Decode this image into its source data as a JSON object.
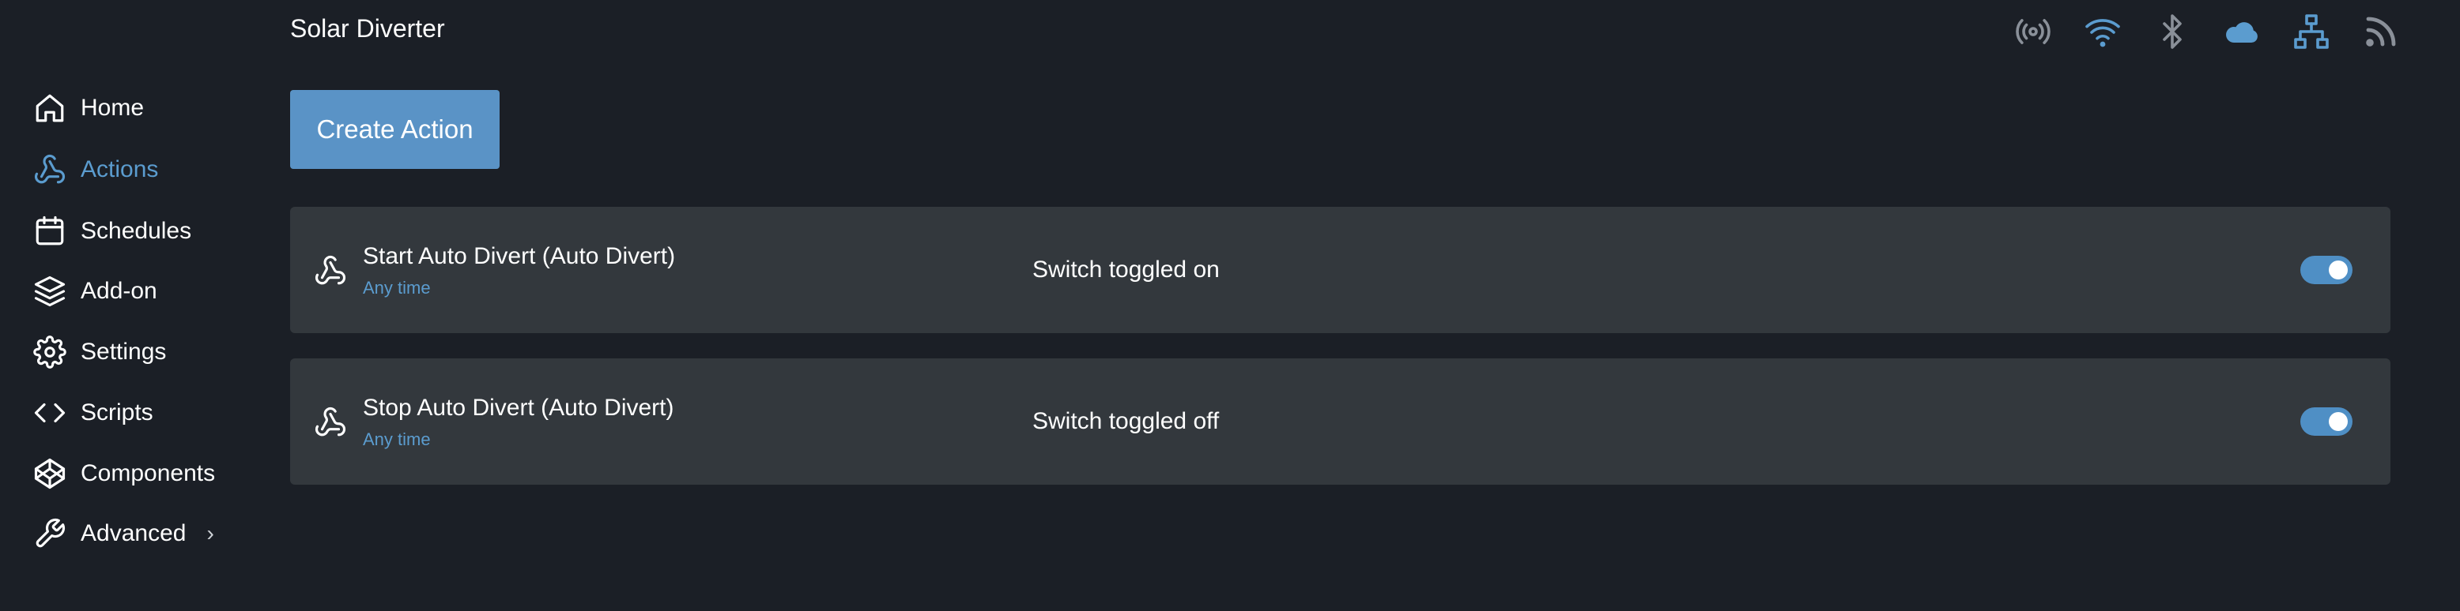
{
  "header": {
    "title": "Solar Diverter"
  },
  "status_icons": [
    {
      "name": "broadcast-icon",
      "color": "#8a9099"
    },
    {
      "name": "wifi-icon",
      "color": "#5b9ccf"
    },
    {
      "name": "bluetooth-icon",
      "color": "#8a9099"
    },
    {
      "name": "cloud-icon",
      "color": "#5b9ccf"
    },
    {
      "name": "network-icon",
      "color": "#5b9ccf"
    },
    {
      "name": "rss-icon",
      "color": "#8a9099"
    }
  ],
  "sidebar": {
    "items": [
      {
        "label": "Home",
        "icon": "home-icon",
        "active": false
      },
      {
        "label": "Actions",
        "icon": "webhook-icon",
        "active": true
      },
      {
        "label": "Schedules",
        "icon": "calendar-icon",
        "active": false
      },
      {
        "label": "Add-on",
        "icon": "layers-icon",
        "active": false
      },
      {
        "label": "Settings",
        "icon": "gear-icon",
        "active": false
      },
      {
        "label": "Scripts",
        "icon": "code-icon",
        "active": false
      },
      {
        "label": "Components",
        "icon": "codepen-icon",
        "active": false
      },
      {
        "label": "Advanced",
        "icon": "wrench-icon",
        "active": false,
        "has_submenu": true
      }
    ],
    "advanced_chevron": "›"
  },
  "main": {
    "create_button": "Create Action",
    "actions": [
      {
        "title": "Start Auto Divert (Auto Divert)",
        "subtitle": "Any time",
        "trigger": "Switch toggled on",
        "enabled": true
      },
      {
        "title": "Stop Auto Divert (Auto Divert)",
        "subtitle": "Any time",
        "trigger": "Switch toggled off",
        "enabled": true
      }
    ]
  },
  "colors": {
    "background": "#1b1f26",
    "card": "#33383d",
    "accent": "#5b9ccf",
    "button": "#5a93c6"
  }
}
